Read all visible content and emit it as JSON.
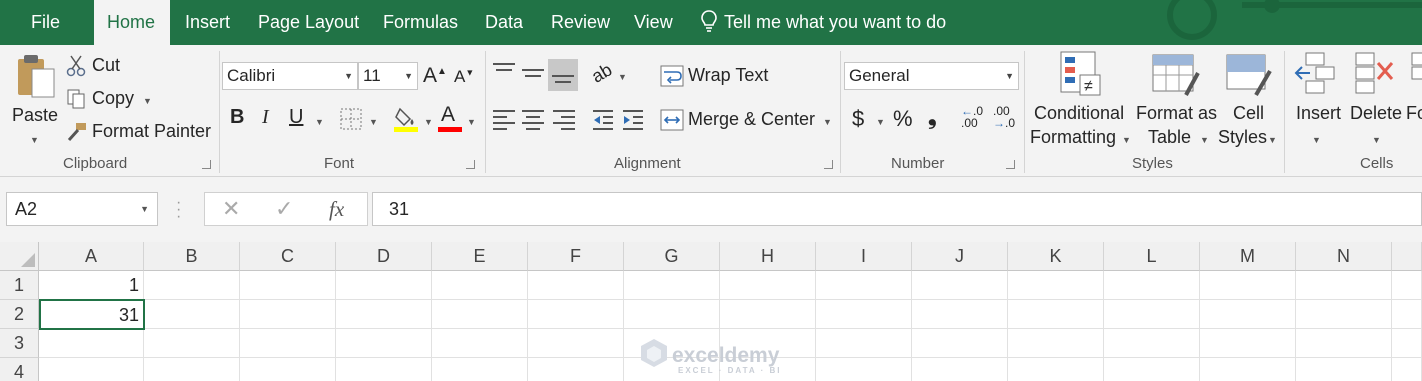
{
  "menu": {
    "tabs": [
      {
        "label": "File"
      },
      {
        "label": "Home"
      },
      {
        "label": "Insert"
      },
      {
        "label": "Page Layout"
      },
      {
        "label": "Formulas"
      },
      {
        "label": "Data"
      },
      {
        "label": "Review"
      },
      {
        "label": "View"
      }
    ],
    "tell_me": "Tell me what you want to do",
    "active_tab": "Home",
    "accent_color": "#217346"
  },
  "ribbon": {
    "clipboard": {
      "paste": "Paste",
      "cut": "Cut",
      "copy": "Copy",
      "format_painter": "Format Painter",
      "group_label": "Clipboard"
    },
    "font": {
      "font_name": "Calibri",
      "font_size": "11",
      "bold": "B",
      "italic": "I",
      "underline": "U",
      "group_label": "Font",
      "fill_color": "#ffff00",
      "font_color": "#ff0000"
    },
    "alignment": {
      "wrap_text": "Wrap Text",
      "merge_center": "Merge & Center",
      "group_label": "Alignment"
    },
    "number": {
      "format": "General",
      "currency": "$",
      "percent": "%",
      "comma": "❟",
      "inc_decimal": ".00",
      "group_label": "Number"
    },
    "styles": {
      "conditional_1": "Conditional",
      "conditional_2": "Formatting",
      "format_table_1": "Format as",
      "format_table_2": "Table",
      "cell_styles_1": "Cell",
      "cell_styles_2": "Styles",
      "group_label": "Styles"
    },
    "cells": {
      "insert": "Insert",
      "delete": "Delete",
      "format": "Fo",
      "group_label": "Cells"
    }
  },
  "formula_bar": {
    "name_box": "A2",
    "fx": "fx",
    "value": "31"
  },
  "grid": {
    "columns": [
      "A",
      "B",
      "C",
      "D",
      "E",
      "F",
      "G",
      "H",
      "I",
      "J",
      "K",
      "L",
      "M",
      "N"
    ],
    "rows": [
      "1",
      "2",
      "3",
      "4"
    ],
    "cells": {
      "A1": "1",
      "A2": "31"
    },
    "selected_cell": "A2"
  },
  "watermark": {
    "name": "exceldemy",
    "tagline": "EXCEL · DATA · BI"
  }
}
